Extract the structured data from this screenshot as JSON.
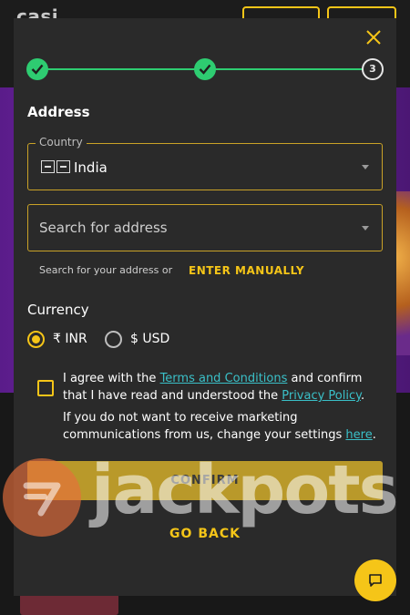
{
  "background": {
    "logo_text": "casi"
  },
  "modal": {
    "close_icon": "close-icon",
    "stepper": {
      "steps": [
        {
          "state": "done",
          "icon": "check-icon"
        },
        {
          "state": "done",
          "icon": "check-icon"
        },
        {
          "state": "current",
          "label": "3"
        }
      ]
    },
    "address": {
      "title": "Address",
      "country": {
        "legend": "Country",
        "value": "India"
      },
      "search": {
        "placeholder": "Search for address",
        "value": ""
      },
      "hint": "Search for your address or",
      "enter_manually": "ENTER MANUALLY"
    },
    "currency": {
      "title": "Currency",
      "options": [
        {
          "label": "₹ INR",
          "selected": true
        },
        {
          "label": "$ USD",
          "selected": false
        }
      ]
    },
    "agreement": {
      "checked": false,
      "text_1": "I agree with the ",
      "terms_link": "Terms and Conditions",
      "text_2": " and confirm that I have read and understood the ",
      "privacy_link": "Privacy Policy",
      "text_3": "."
    },
    "marketing": {
      "text_1": "If you do not want to receive marketing communications from us, change your settings ",
      "here_link": "here",
      "text_2": "."
    },
    "confirm_label": "CONFIRM",
    "go_back_label": "GO BACK"
  },
  "watermark": {
    "text": "jackpots"
  },
  "chat": {
    "icon": "chat-icon"
  },
  "colors": {
    "accent": "#f5c518",
    "success": "#2ecc71",
    "link": "#3ac0c8",
    "modal_bg": "#2a2a2a"
  }
}
